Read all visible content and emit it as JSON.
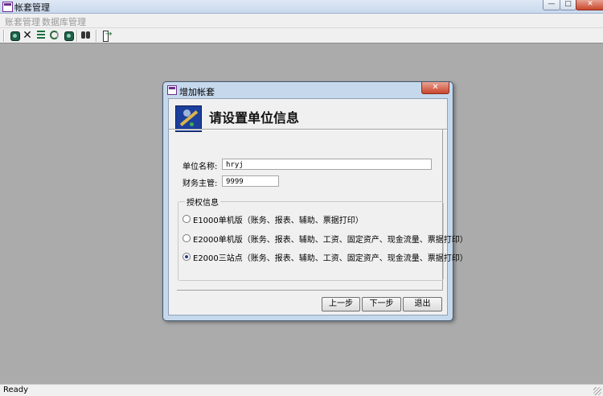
{
  "window": {
    "title": "帐套管理",
    "controls": {
      "minimize": "—",
      "maximize": "□",
      "close": "✕"
    }
  },
  "menu": {
    "items": [
      "账套管理",
      "数据库管理"
    ]
  },
  "toolbar": {
    "icons": [
      "database-icon",
      "delete-icon",
      "grid-icon",
      "refresh-icon",
      "binoculars-icon",
      "exit-icon"
    ]
  },
  "status": {
    "text": "Ready"
  },
  "dialog": {
    "title": "增加帐套",
    "close": "✕",
    "heading": "请设置单位信息",
    "fields": {
      "unit_name_label": "单位名称:",
      "unit_name_value": "hryj",
      "manager_label": "财务主管:",
      "manager_value": "9999"
    },
    "license": {
      "caption": "授权信息",
      "options": [
        {
          "label": "E1000单机版（账务、报表、辅助、票据打印）",
          "selected": false
        },
        {
          "label": "E2000单机版（账务、报表、辅助、工资、固定资产、现金流量、票据打印）",
          "selected": false
        },
        {
          "label": "E2000三站点（账务、报表、辅助、工资、固定资产、现金流量、票据打印）",
          "selected": true
        }
      ]
    },
    "buttons": {
      "prev": "上一步",
      "next": "下一步",
      "exit": "退出"
    }
  }
}
